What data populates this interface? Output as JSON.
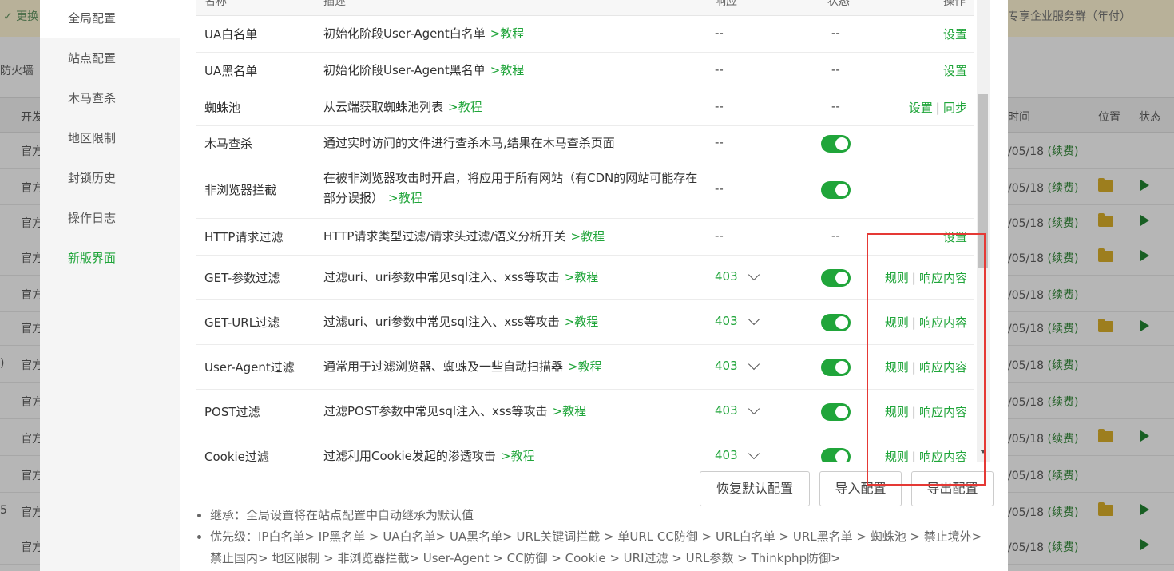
{
  "background": {
    "banner_left": "✓ 更换",
    "banner_right": "专享企业服务群（年付）",
    "firewall_label": "防火墙",
    "columns": {
      "dev": "开发",
      "time": "时间",
      "location": "位置",
      "status": "状态"
    },
    "rows": [
      {
        "prefix": "",
        "source": "官方",
        "date": "/05/18",
        "renew": "(续费)"
      },
      {
        "prefix": "",
        "source": "官方",
        "date": "/05/18",
        "renew": "(续费)"
      },
      {
        "prefix": "",
        "source": "官方",
        "date": "/05/18",
        "renew": "(续费)"
      },
      {
        "prefix": "",
        "source": "官方",
        "date": "/05/18",
        "renew": "(续费)"
      },
      {
        "prefix": "",
        "source": "官方",
        "date": "/05/18",
        "renew": "(续费)"
      },
      {
        "prefix": "",
        "source": "官方",
        "date": "/05/18",
        "renew": "(续费)"
      },
      {
        "prefix": ")",
        "source": "官方",
        "date": "/05/18",
        "renew": "(续费)"
      },
      {
        "prefix": "",
        "source": "官方",
        "date": "/05/18",
        "renew": "(续费)"
      },
      {
        "prefix": "",
        "source": "官方",
        "date": "/05/18",
        "renew": "(续费)"
      },
      {
        "prefix": "",
        "source": "官方",
        "date": "/05/18",
        "renew": "(续费)"
      },
      {
        "prefix": "5",
        "source": "官方",
        "date": "/05/18",
        "renew": "(续费)"
      },
      {
        "prefix": "",
        "source": "官方",
        "date": "/05/18",
        "renew": "(续费)"
      }
    ]
  },
  "sidebar": {
    "items": [
      {
        "label": "全局配置"
      },
      {
        "label": "站点配置"
      },
      {
        "label": "木马查杀"
      },
      {
        "label": "地区限制"
      },
      {
        "label": "封锁历史"
      },
      {
        "label": "操作日志"
      },
      {
        "label": "新版界面"
      }
    ]
  },
  "table": {
    "headers": {
      "name": "名称",
      "desc": "描述",
      "response": "响应",
      "status": "状态",
      "ops": "操作"
    },
    "tutorial": ">教程",
    "rows": [
      {
        "name": "UA白名单",
        "desc": "初始化阶段User-Agent白名单",
        "status": "--",
        "switch": "--",
        "ops": [
          "设置"
        ]
      },
      {
        "name": "UA黑名单",
        "desc": "初始化阶段User-Agent黑名单",
        "status": "--",
        "switch": "--",
        "ops": [
          "设置"
        ]
      },
      {
        "name": "蜘蛛池",
        "desc": "从云端获取蜘蛛池列表",
        "status": "--",
        "switch": "--",
        "ops": [
          "设置",
          "同步"
        ]
      },
      {
        "name": "木马查杀",
        "desc": "通过实时访问的文件进行查杀木马,结果在木马查杀页面",
        "status": "--",
        "switch": "on",
        "ops": []
      },
      {
        "name": "非浏览器拦截",
        "desc": "在被非浏览器攻击时开启，将应用于所有网站（有CDN的网站可能存在部分误报）",
        "status": "--",
        "switch": "on",
        "ops": []
      },
      {
        "name": "HTTP请求过滤",
        "desc": "HTTP请求类型过滤/请求头过滤/语义分析开关",
        "status": "--",
        "switch": "--",
        "ops": [
          "设置"
        ]
      },
      {
        "name": "GET-参数过滤",
        "desc": "过滤uri、uri参数中常见sql注入、xss等攻击",
        "status": "403",
        "switch": "on",
        "ops": [
          "规则",
          "响应内容"
        ]
      },
      {
        "name": "GET-URL过滤",
        "desc": "过滤uri、uri参数中常见sql注入、xss等攻击",
        "status": "403",
        "switch": "on",
        "ops": [
          "规则",
          "响应内容"
        ]
      },
      {
        "name": "User-Agent过滤",
        "desc": "通常用于过滤浏览器、蜘蛛及一些自动扫描器",
        "status": "403",
        "switch": "on",
        "ops": [
          "规则",
          "响应内容"
        ]
      },
      {
        "name": "POST过滤",
        "desc": "过滤POST参数中常见sql注入、xss等攻击",
        "status": "403",
        "switch": "on",
        "ops": [
          "规则",
          "响应内容"
        ]
      },
      {
        "name": "Cookie过滤",
        "desc": "过滤利用Cookie发起的渗透攻击",
        "status": "403",
        "switch": "on",
        "ops": [
          "规则",
          "响应内容"
        ]
      }
    ]
  },
  "buttons": {
    "restore": "恢复默认配置",
    "import": "导入配置",
    "export": "导出配置"
  },
  "notes": [
    "继承：全局设置将在站点配置中自动继承为默认值",
    "优先级：IP白名单> IP黑名单 > UA白名单> UA黑名单> URL关键词拦截 > 单URL CC防御 > URL白名单 > URL黑名单 > 蜘蛛池 > 禁止境外> 禁止国内> 地区限制 > 非浏览器拦截> User-Agent > CC防御 > Cookie > URI过滤 > URL参数 > Thinkphp防御>"
  ],
  "colors": {
    "accent": "#20a53a",
    "highlight_box": "#e53935"
  }
}
